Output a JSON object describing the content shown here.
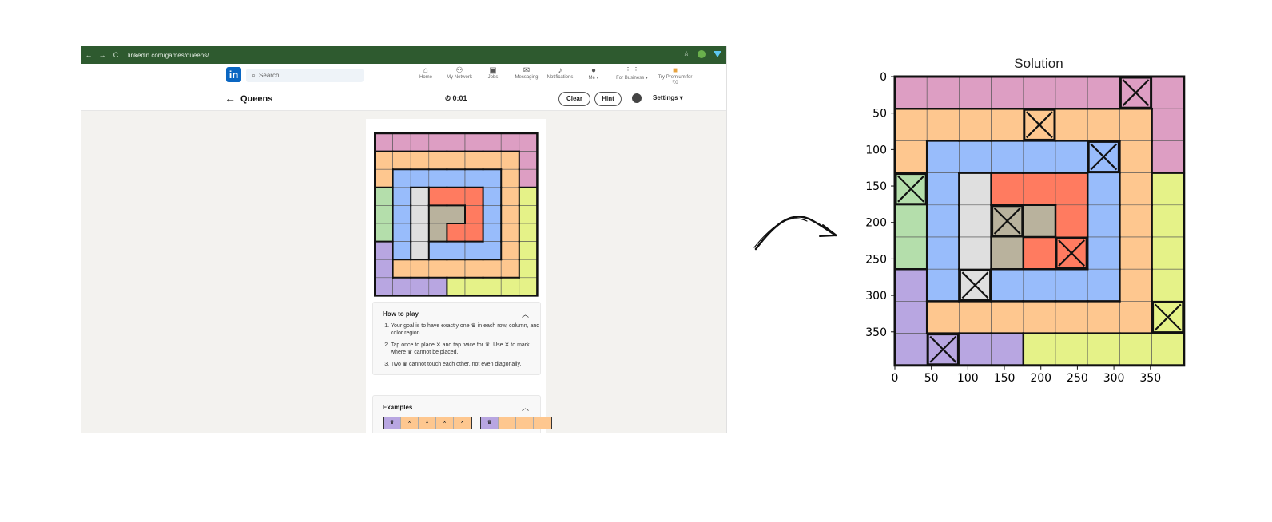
{
  "browser": {
    "url": "linkedin.com/games/queens/",
    "back_icon": "←",
    "forward_icon": "→",
    "reload_icon": "C",
    "star_icon": "☆"
  },
  "linkedin": {
    "logo": "in",
    "search_placeholder": "Search",
    "nav": [
      {
        "label": "Home",
        "icon": "home-icon"
      },
      {
        "label": "My Network",
        "icon": "network-icon"
      },
      {
        "label": "Jobs",
        "icon": "briefcase-icon"
      },
      {
        "label": "Messaging",
        "icon": "message-icon"
      },
      {
        "label": "Notifications",
        "icon": "bell-icon"
      },
      {
        "label": "Me ▾",
        "icon": "avatar-icon"
      },
      {
        "label": "For Business ▾",
        "icon": "grid-icon"
      },
      {
        "label": "Try Premium for ₹0",
        "icon": "premium-icon"
      }
    ]
  },
  "game": {
    "back": "←",
    "title": "Queens",
    "timer": "0:01",
    "clear": "Clear",
    "hint": "Hint",
    "settings": "Settings ▾",
    "how_to_play": {
      "title": "How to play",
      "rules": [
        "Your goal is to have exactly one ♛ in each row, column, and color region.",
        "Tap once to place ✕ and tap twice for ♛. Use ✕ to mark where ♛ cannot be placed.",
        "Two ♛ cannot touch each other, not even diagonally."
      ]
    },
    "examples": {
      "title": "Examples",
      "row1": [
        "♛",
        "×",
        "×",
        "×",
        "×"
      ],
      "row2": [
        "♛",
        "",
        "",
        ""
      ]
    }
  },
  "colors": {
    "P": "#dd9ec3",
    "O": "#fec78f",
    "B": "#98bcfb",
    "G": "#b4deab",
    "W": "#dfdfdf",
    "R": "#ff7b60",
    "T": "#b9b29d",
    "V": "#b8a6e1",
    "Y": "#e5f288"
  },
  "board": {
    "rows": [
      "PPPPPPPPP",
      "OOOOOOOOP",
      "OBBBBBBOP",
      "GBWRRRBOY",
      "GBWTTRBOY",
      "GBWTRRBOY",
      "VBWBBBBOY",
      "VOOOOOOOY",
      "VVVVYYYYY"
    ],
    "queens": [
      [
        0,
        7
      ],
      [
        1,
        4
      ],
      [
        2,
        6
      ],
      [
        3,
        0
      ],
      [
        4,
        3
      ],
      [
        5,
        5
      ],
      [
        6,
        2
      ],
      [
        7,
        8
      ],
      [
        8,
        1
      ]
    ]
  },
  "solution": {
    "title": "Solution",
    "x_ticks": [
      "0",
      "50",
      "100",
      "150",
      "200",
      "250",
      "300",
      "350"
    ],
    "y_ticks": [
      "0",
      "50",
      "100",
      "150",
      "200",
      "250",
      "300",
      "350"
    ]
  }
}
